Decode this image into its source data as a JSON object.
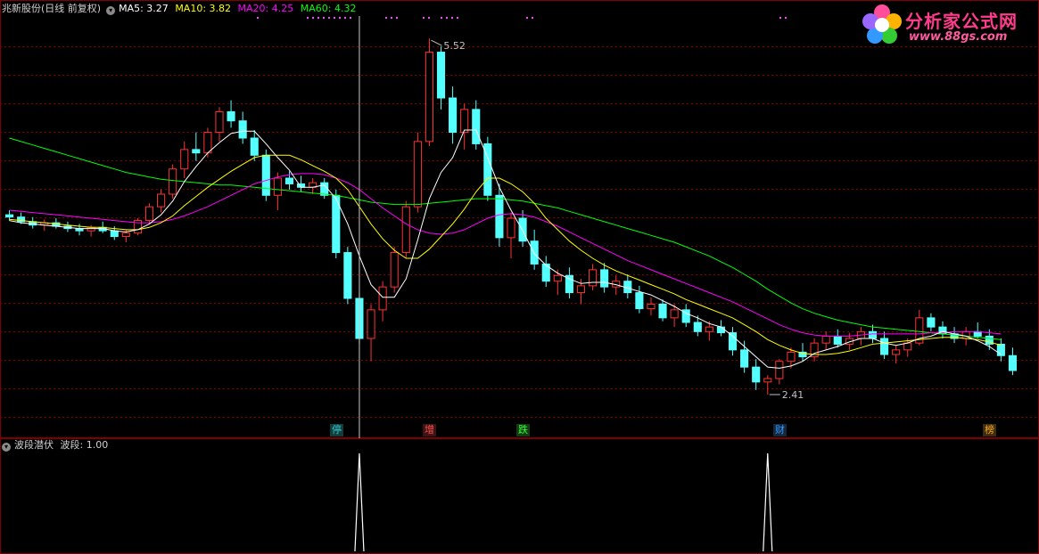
{
  "header": {
    "title": "兆新股份(日线 前复权)",
    "ma5_label": "MA5: 3.27",
    "ma10_label": "MA10: 3.82",
    "ma20_label": "MA20: 4.25",
    "ma60_label": "MA60: 4.32",
    "menu_icon": "chevron-down-icon"
  },
  "indicator_header": {
    "name": "波段潜伏",
    "value_label": "波段: 1.00"
  },
  "annotations": {
    "high_label": "5.52",
    "low_label": "2.41"
  },
  "events": [
    {
      "label": "停",
      "color": "#33c9c9"
    },
    {
      "label": "增",
      "color": "#ff5050"
    },
    {
      "label": "跌",
      "color": "#33ff33"
    },
    {
      "label": "财",
      "color": "#3399ff"
    },
    {
      "label": "榜",
      "color": "#ffaa00"
    }
  ],
  "logo": {
    "name": "分析家公式网",
    "url": "www.88gs.com"
  },
  "colors": {
    "background": "#000000",
    "up_candle": "#ff3232",
    "down_candle": "#54ffff",
    "grid": "#800000",
    "ma5": "#ffffff",
    "ma10": "#ffff00",
    "ma20": "#ff00ff",
    "ma60": "#00ff00"
  },
  "chart_data": {
    "type": "candlestick",
    "title": "兆新股份(日线 前复权)",
    "price_range": [
      2.41,
      5.52
    ],
    "ylim": [
      2.2,
      5.7
    ],
    "grid": true,
    "candles": [
      {
        "o": 3.98,
        "h": 4.02,
        "l": 3.93,
        "c": 3.96
      },
      {
        "o": 3.96,
        "h": 4.0,
        "l": 3.9,
        "c": 3.92
      },
      {
        "o": 3.92,
        "h": 3.96,
        "l": 3.86,
        "c": 3.89
      },
      {
        "o": 3.89,
        "h": 3.94,
        "l": 3.84,
        "c": 3.91
      },
      {
        "o": 3.91,
        "h": 3.95,
        "l": 3.86,
        "c": 3.88
      },
      {
        "o": 3.88,
        "h": 3.92,
        "l": 3.83,
        "c": 3.86
      },
      {
        "o": 3.86,
        "h": 3.9,
        "l": 3.8,
        "c": 3.84
      },
      {
        "o": 3.84,
        "h": 3.89,
        "l": 3.79,
        "c": 3.87
      },
      {
        "o": 3.87,
        "h": 3.92,
        "l": 3.82,
        "c": 3.84
      },
      {
        "o": 3.84,
        "h": 3.88,
        "l": 3.76,
        "c": 3.79
      },
      {
        "o": 3.79,
        "h": 3.85,
        "l": 3.74,
        "c": 3.82
      },
      {
        "o": 3.82,
        "h": 3.95,
        "l": 3.8,
        "c": 3.93
      },
      {
        "o": 3.93,
        "h": 4.08,
        "l": 3.9,
        "c": 4.05
      },
      {
        "o": 4.05,
        "h": 4.2,
        "l": 4.0,
        "c": 4.16
      },
      {
        "o": 4.16,
        "h": 4.42,
        "l": 4.12,
        "c": 4.38
      },
      {
        "o": 4.38,
        "h": 4.62,
        "l": 4.3,
        "c": 4.55
      },
      {
        "o": 4.55,
        "h": 4.7,
        "l": 4.45,
        "c": 4.52
      },
      {
        "o": 4.52,
        "h": 4.74,
        "l": 4.48,
        "c": 4.7
      },
      {
        "o": 4.7,
        "h": 4.92,
        "l": 4.62,
        "c": 4.88
      },
      {
        "o": 4.88,
        "h": 4.98,
        "l": 4.74,
        "c": 4.8
      },
      {
        "o": 4.8,
        "h": 4.88,
        "l": 4.6,
        "c": 4.65
      },
      {
        "o": 4.65,
        "h": 4.72,
        "l": 4.45,
        "c": 4.5
      },
      {
        "o": 4.5,
        "h": 4.55,
        "l": 4.1,
        "c": 4.15
      },
      {
        "o": 4.15,
        "h": 4.35,
        "l": 4.02,
        "c": 4.3
      },
      {
        "o": 4.3,
        "h": 4.36,
        "l": 4.2,
        "c": 4.25
      },
      {
        "o": 4.25,
        "h": 4.32,
        "l": 4.18,
        "c": 4.22
      },
      {
        "o": 4.22,
        "h": 4.3,
        "l": 4.16,
        "c": 4.26
      },
      {
        "o": 4.26,
        "h": 4.3,
        "l": 4.12,
        "c": 4.15
      },
      {
        "o": 4.15,
        "h": 4.2,
        "l": 3.6,
        "c": 3.65
      },
      {
        "o": 3.65,
        "h": 3.7,
        "l": 3.2,
        "c": 3.25
      },
      {
        "o": 3.25,
        "h": 3.3,
        "l": 2.85,
        "c": 2.9
      },
      {
        "o": 2.9,
        "h": 3.2,
        "l": 2.7,
        "c": 3.15
      },
      {
        "o": 3.15,
        "h": 3.4,
        "l": 3.05,
        "c": 3.35
      },
      {
        "o": 3.35,
        "h": 3.7,
        "l": 3.3,
        "c": 3.65
      },
      {
        "o": 3.65,
        "h": 4.1,
        "l": 3.6,
        "c": 4.05
      },
      {
        "o": 4.05,
        "h": 4.7,
        "l": 4.0,
        "c": 4.62
      },
      {
        "o": 4.62,
        "h": 5.52,
        "l": 4.58,
        "c": 5.4
      },
      {
        "o": 5.4,
        "h": 5.45,
        "l": 4.9,
        "c": 5.0
      },
      {
        "o": 5.0,
        "h": 5.1,
        "l": 4.6,
        "c": 4.7
      },
      {
        "o": 4.7,
        "h": 4.95,
        "l": 4.55,
        "c": 4.9
      },
      {
        "o": 4.9,
        "h": 4.98,
        "l": 4.55,
        "c": 4.6
      },
      {
        "o": 4.6,
        "h": 4.66,
        "l": 4.1,
        "c": 4.15
      },
      {
        "o": 4.15,
        "h": 4.25,
        "l": 3.7,
        "c": 3.78
      },
      {
        "o": 3.78,
        "h": 4.0,
        "l": 3.6,
        "c": 3.95
      },
      {
        "o": 3.95,
        "h": 4.02,
        "l": 3.7,
        "c": 3.75
      },
      {
        "o": 3.75,
        "h": 3.85,
        "l": 3.5,
        "c": 3.55
      },
      {
        "o": 3.55,
        "h": 3.62,
        "l": 3.35,
        "c": 3.4
      },
      {
        "o": 3.4,
        "h": 3.5,
        "l": 3.28,
        "c": 3.45
      },
      {
        "o": 3.45,
        "h": 3.52,
        "l": 3.25,
        "c": 3.3
      },
      {
        "o": 3.3,
        "h": 3.42,
        "l": 3.2,
        "c": 3.36
      },
      {
        "o": 3.36,
        "h": 3.55,
        "l": 3.32,
        "c": 3.5
      },
      {
        "o": 3.5,
        "h": 3.56,
        "l": 3.3,
        "c": 3.35
      },
      {
        "o": 3.35,
        "h": 3.45,
        "l": 3.28,
        "c": 3.4
      },
      {
        "o": 3.4,
        "h": 3.46,
        "l": 3.25,
        "c": 3.3
      },
      {
        "o": 3.3,
        "h": 3.36,
        "l": 3.12,
        "c": 3.16
      },
      {
        "o": 3.16,
        "h": 3.26,
        "l": 3.1,
        "c": 3.2
      },
      {
        "o": 3.2,
        "h": 3.24,
        "l": 3.05,
        "c": 3.08
      },
      {
        "o": 3.08,
        "h": 3.2,
        "l": 3.0,
        "c": 3.15
      },
      {
        "o": 3.15,
        "h": 3.2,
        "l": 3.0,
        "c": 3.04
      },
      {
        "o": 3.04,
        "h": 3.1,
        "l": 2.92,
        "c": 2.96
      },
      {
        "o": 2.96,
        "h": 3.05,
        "l": 2.88,
        "c": 3.0
      },
      {
        "o": 3.0,
        "h": 3.06,
        "l": 2.92,
        "c": 2.95
      },
      {
        "o": 2.95,
        "h": 3.0,
        "l": 2.75,
        "c": 2.8
      },
      {
        "o": 2.8,
        "h": 2.88,
        "l": 2.6,
        "c": 2.65
      },
      {
        "o": 2.65,
        "h": 2.72,
        "l": 2.45,
        "c": 2.52
      },
      {
        "o": 2.52,
        "h": 2.58,
        "l": 2.41,
        "c": 2.55
      },
      {
        "o": 2.55,
        "h": 2.72,
        "l": 2.5,
        "c": 2.7
      },
      {
        "o": 2.7,
        "h": 2.82,
        "l": 2.64,
        "c": 2.78
      },
      {
        "o": 2.78,
        "h": 2.86,
        "l": 2.7,
        "c": 2.74
      },
      {
        "o": 2.74,
        "h": 2.9,
        "l": 2.7,
        "c": 2.86
      },
      {
        "o": 2.86,
        "h": 2.96,
        "l": 2.8,
        "c": 2.92
      },
      {
        "o": 2.92,
        "h": 2.98,
        "l": 2.82,
        "c": 2.85
      },
      {
        "o": 2.85,
        "h": 2.95,
        "l": 2.8,
        "c": 2.9
      },
      {
        "o": 2.9,
        "h": 3.0,
        "l": 2.84,
        "c": 2.96
      },
      {
        "o": 2.96,
        "h": 3.02,
        "l": 2.86,
        "c": 2.9
      },
      {
        "o": 2.9,
        "h": 2.96,
        "l": 2.72,
        "c": 2.76
      },
      {
        "o": 2.76,
        "h": 2.84,
        "l": 2.68,
        "c": 2.8
      },
      {
        "o": 2.8,
        "h": 2.9,
        "l": 2.74,
        "c": 2.86
      },
      {
        "o": 2.86,
        "h": 3.15,
        "l": 2.84,
        "c": 3.08
      },
      {
        "o": 3.08,
        "h": 3.12,
        "l": 2.96,
        "c": 3.0
      },
      {
        "o": 3.0,
        "h": 3.05,
        "l": 2.9,
        "c": 2.94
      },
      {
        "o": 2.94,
        "h": 3.0,
        "l": 2.86,
        "c": 2.9
      },
      {
        "o": 2.9,
        "h": 3.0,
        "l": 2.84,
        "c": 2.96
      },
      {
        "o": 2.96,
        "h": 3.04,
        "l": 2.9,
        "c": 2.92
      },
      {
        "o": 2.92,
        "h": 2.98,
        "l": 2.8,
        "c": 2.85
      },
      {
        "o": 2.85,
        "h": 2.9,
        "l": 2.7,
        "c": 2.75
      },
      {
        "o": 2.75,
        "h": 2.82,
        "l": 2.58,
        "c": 2.62
      }
    ],
    "ma5": [
      3.93,
      3.91,
      3.9,
      3.89,
      3.88,
      3.87,
      3.86,
      3.86,
      3.86,
      3.84,
      3.83,
      3.85,
      3.9,
      3.98,
      4.1,
      4.27,
      4.4,
      4.52,
      4.61,
      4.69,
      4.71,
      4.71,
      4.6,
      4.48,
      4.37,
      4.22,
      4.22,
      4.24,
      4.12,
      3.9,
      3.62,
      3.37,
      3.26,
      3.26,
      3.42,
      3.76,
      4.12,
      4.35,
      4.48,
      4.72,
      4.72,
      4.48,
      4.22,
      4.02,
      3.84,
      3.64,
      3.54,
      3.47,
      3.42,
      3.38,
      3.39,
      3.39,
      3.37,
      3.34,
      3.31,
      3.28,
      3.23,
      3.18,
      3.12,
      3.08,
      3.03,
      3.0,
      2.92,
      2.83,
      2.74,
      2.65,
      2.64,
      2.66,
      2.7,
      2.77,
      2.8,
      2.83,
      2.87,
      2.9,
      2.9,
      2.86,
      2.84,
      2.86,
      2.9,
      2.92,
      2.96,
      2.94,
      2.92,
      2.88,
      2.83,
      2.76
    ],
    "ma10": [
      3.94,
      3.93,
      3.92,
      3.91,
      3.9,
      3.89,
      3.88,
      3.87,
      3.87,
      3.86,
      3.85,
      3.85,
      3.87,
      3.91,
      3.97,
      4.06,
      4.14,
      4.22,
      4.29,
      4.36,
      4.42,
      4.48,
      4.5,
      4.5,
      4.5,
      4.46,
      4.41,
      4.36,
      4.3,
      4.2,
      4.05,
      3.9,
      3.77,
      3.67,
      3.6,
      3.6,
      3.68,
      3.79,
      3.9,
      4.03,
      4.18,
      4.3,
      4.3,
      4.25,
      4.18,
      4.08,
      3.95,
      3.85,
      3.75,
      3.67,
      3.6,
      3.54,
      3.49,
      3.45,
      3.41,
      3.37,
      3.33,
      3.29,
      3.24,
      3.2,
      3.16,
      3.12,
      3.08,
      3.02,
      2.96,
      2.89,
      2.84,
      2.8,
      2.77,
      2.76,
      2.76,
      2.77,
      2.79,
      2.82,
      2.85,
      2.86,
      2.87,
      2.88,
      2.89,
      2.9,
      2.91,
      2.91,
      2.9,
      2.89,
      2.87,
      2.84
    ],
    "ma20": [
      4.02,
      4.01,
      4.0,
      3.99,
      3.98,
      3.97,
      3.96,
      3.95,
      3.94,
      3.93,
      3.92,
      3.91,
      3.91,
      3.92,
      3.94,
      3.97,
      4.01,
      4.05,
      4.1,
      4.15,
      4.2,
      4.25,
      4.28,
      4.31,
      4.33,
      4.34,
      4.34,
      4.33,
      4.3,
      4.26,
      4.2,
      4.12,
      4.04,
      3.97,
      3.9,
      3.85,
      3.82,
      3.81,
      3.82,
      3.85,
      3.9,
      3.95,
      3.98,
      3.99,
      3.98,
      3.96,
      3.92,
      3.88,
      3.83,
      3.78,
      3.73,
      3.68,
      3.63,
      3.58,
      3.54,
      3.5,
      3.46,
      3.42,
      3.38,
      3.34,
      3.3,
      3.26,
      3.22,
      3.17,
      3.12,
      3.07,
      3.02,
      2.98,
      2.95,
      2.93,
      2.92,
      2.92,
      2.92,
      2.93,
      2.94,
      2.94,
      2.94,
      2.94,
      2.94,
      2.95,
      2.95,
      2.96,
      2.96,
      2.96,
      2.95,
      2.94
    ],
    "ma60": [
      4.65,
      4.62,
      4.59,
      4.56,
      4.53,
      4.5,
      4.47,
      4.44,
      4.41,
      4.38,
      4.35,
      4.33,
      4.31,
      4.29,
      4.28,
      4.27,
      4.26,
      4.25,
      4.24,
      4.24,
      4.23,
      4.22,
      4.21,
      4.2,
      4.19,
      4.18,
      4.17,
      4.16,
      4.15,
      4.13,
      4.11,
      4.09,
      4.08,
      4.07,
      4.07,
      4.07,
      4.08,
      4.09,
      4.1,
      4.11,
      4.12,
      4.12,
      4.12,
      4.11,
      4.1,
      4.08,
      4.06,
      4.04,
      4.01,
      3.98,
      3.95,
      3.92,
      3.89,
      3.86,
      3.83,
      3.8,
      3.77,
      3.74,
      3.7,
      3.66,
      3.62,
      3.57,
      3.52,
      3.46,
      3.4,
      3.33,
      3.27,
      3.21,
      3.16,
      3.12,
      3.09,
      3.06,
      3.04,
      3.02,
      3.0,
      2.99,
      2.98,
      2.97,
      2.96,
      2.95,
      2.94,
      2.93,
      2.92,
      2.91,
      2.9,
      2.89
    ],
    "indicator": {
      "name": "波段潜伏",
      "series_name": "波段",
      "value": 1.0,
      "signals": [
        30,
        65
      ]
    }
  }
}
